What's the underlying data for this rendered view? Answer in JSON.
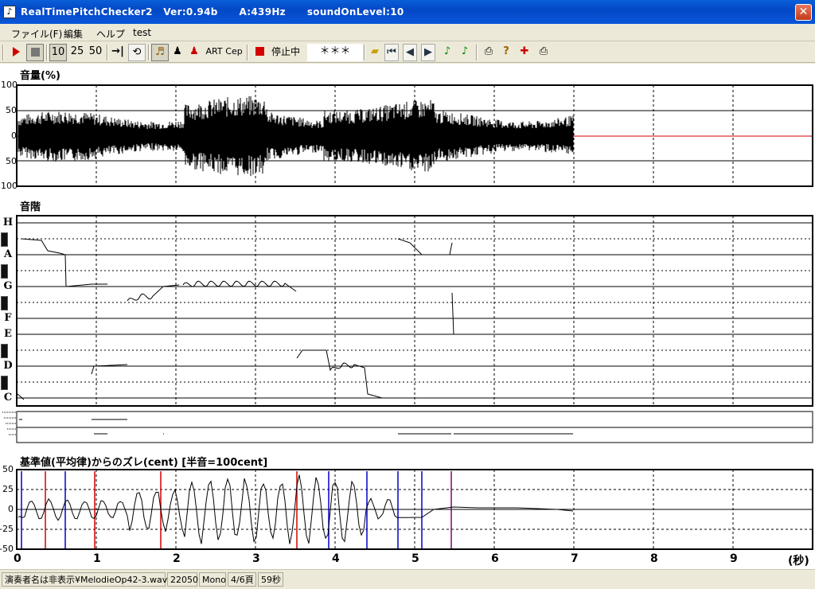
{
  "window": {
    "title": "RealTimePitchChecker2   Ver:0.94b      A:439Hz      soundOnLevel:10",
    "close_glyph": "✕",
    "icon_glyph": "♪"
  },
  "menu": {
    "items": [
      "ファイル(F)",
      "編集",
      "ヘルプ",
      "test"
    ]
  },
  "toolbar": {
    "speed_10": "10",
    "speed_25": "25",
    "speed_50": "50",
    "art_label": "ART",
    "cep_label": "Cep",
    "status": "停止中",
    "pitch_display": "＊＊＊"
  },
  "panels": {
    "volume": {
      "title": "音量(%)",
      "y_ticks": [
        "100",
        "50",
        "0",
        "50",
        "100"
      ]
    },
    "scale": {
      "title": "音階",
      "notes": [
        "H",
        "A",
        "G",
        "F",
        "E",
        "D",
        "C"
      ]
    },
    "deviation": {
      "title": "基準値(平均律)からのズレ(cent) [半音=100cent]",
      "y_ticks": [
        "50",
        "25",
        "0",
        "-25",
        "-50"
      ]
    }
  },
  "x_axis": {
    "ticks": [
      "0",
      "1",
      "2",
      "3",
      "4",
      "5",
      "6",
      "7",
      "8",
      "9"
    ],
    "unit_label": "(秒)"
  },
  "status_bar": {
    "file": "演奏者名は非表示¥MelodieOp42-3.wav",
    "rate": "22050",
    "channels": "Mono",
    "page": "4/6頁",
    "duration": "59秒"
  },
  "colors": {
    "titlebar": "#0a56d8",
    "signal": "#000000",
    "reference_line": "#d40000",
    "marker_blue": "#0000c8",
    "marker_red": "#d40000",
    "marker_purple": "#800080"
  }
}
